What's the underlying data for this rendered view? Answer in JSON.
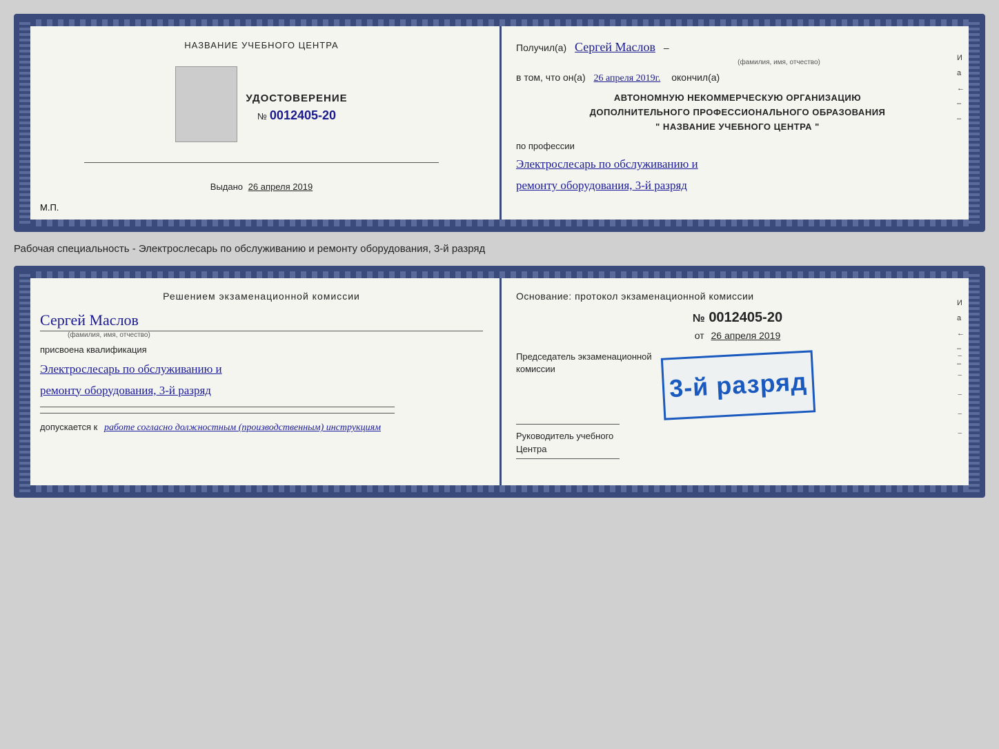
{
  "top_card": {
    "left": {
      "school_name": "НАЗВАНИЕ УЧЕБНОГО ЦЕНТРА",
      "photo_alt": "фото",
      "udost_label": "УДОСТОВЕРЕНИЕ",
      "number_prefix": "№",
      "number": "0012405-20",
      "issued_label": "Выдано",
      "issued_date": "26 апреля 2019",
      "mp_label": "М.П."
    },
    "right": {
      "received_prefix": "Получил(а)",
      "recipient_name": "Сергей Маслов",
      "fio_label": "(фамилия, имя, отчество)",
      "dash": "–",
      "vtom_prefix": "в том, что он(а)",
      "vtom_date": "26 апреля 2019г.",
      "finished_label": "окончил(а)",
      "org_line1": "АВТОНОМНУЮ НЕКОММЕРЧЕСКУЮ ОРГАНИЗАЦИЮ",
      "org_line2": "ДОПОЛНИТЕЛЬНОГО ПРОФЕССИОНАЛЬНОГО ОБРАЗОВАНИЯ",
      "org_line3": "\"  НАЗВАНИЕ УЧЕБНОГО ЦЕНТРА  \"",
      "po_professii": "по профессии",
      "profession_line1": "Электрослесарь по обслуживанию и",
      "profession_line2": "ремонту оборудования, 3-й разряд"
    }
  },
  "between_label": "Рабочая специальность - Электрослесарь по обслуживанию и ремонту оборудования, 3-й разряд",
  "bottom_card": {
    "left": {
      "resheniem_title": "Решением  экзаменационной  комиссии",
      "name": "Сергей Маслов",
      "fio_label": "(фамилия, имя, отчество)",
      "prisvoena": "присвоена квалификация",
      "profession_line1": "Электрослесарь по обслуживанию и",
      "profession_line2": "ремонту оборудования, 3-й разряд",
      "dopuskaetsya_prefix": "допускается к",
      "dopusk_text": "работе согласно должностным (производственным) инструкциям"
    },
    "right": {
      "osnovaniye_label": "Основание: протокол экзаменационной  комиссии",
      "number_prefix": "№",
      "protocol_number": "0012405-20",
      "ot_prefix": "от",
      "ot_date": "26 апреля 2019",
      "chairman_line1": "Председатель экзаменационной",
      "chairman_line2": "комиссии",
      "stamp_text": "3-й разряд",
      "rukovoditel_line1": "Руководитель учебного",
      "rukovoditel_line2": "Центра"
    }
  },
  "side_letters": {
    "right1": "И",
    "right2": "а",
    "right3": "←",
    "right4": "–",
    "right5": "–"
  }
}
